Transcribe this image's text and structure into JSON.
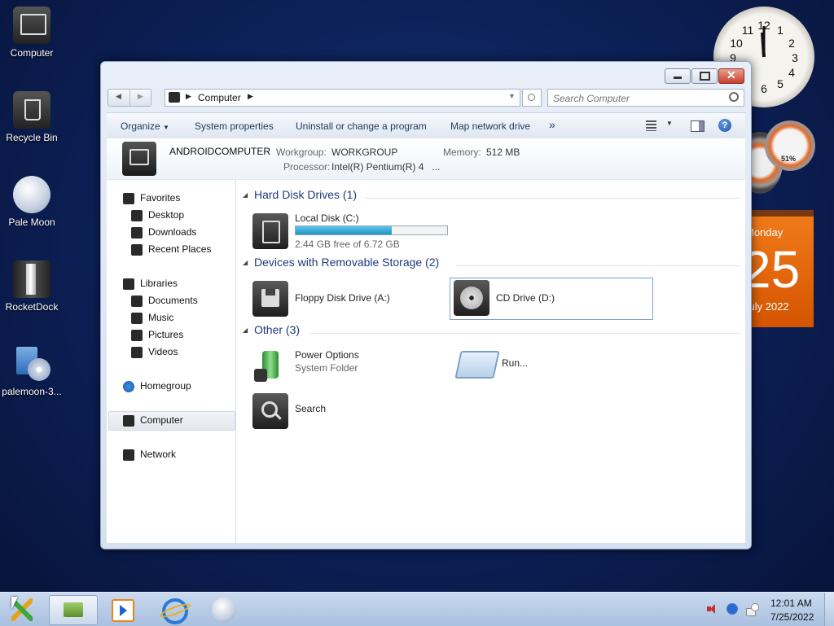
{
  "desktop": {
    "icons": [
      {
        "label": "Computer",
        "icon": "computer-icon"
      },
      {
        "label": "Recycle Bin",
        "icon": "recycle-bin-icon"
      },
      {
        "label": "Pale Moon",
        "icon": "pale-moon-icon"
      },
      {
        "label": "RocketDock",
        "icon": "rocketdock-icon"
      },
      {
        "label": "palemoon-3...",
        "icon": "installer-icon"
      }
    ]
  },
  "gadgets": {
    "calendar": {
      "day_name": "Monday",
      "day": "25",
      "month_year": "July 2022"
    },
    "meter": {
      "value": "51%"
    }
  },
  "window": {
    "address": {
      "root_label": "Computer"
    },
    "search": {
      "placeholder": "Search Computer"
    },
    "toolbar": {
      "organize": "Organize",
      "system_properties": "System properties",
      "uninstall": "Uninstall or change a program",
      "map_drive": "Map network drive",
      "more": "»"
    },
    "info": {
      "name": "ANDROIDCOMPUTER",
      "workgroup_label": "Workgroup:",
      "workgroup": "WORKGROUP",
      "memory_label": "Memory:",
      "memory": "512 MB",
      "processor_label": "Processor:",
      "processor": "Intel(R) Pentium(R) 4   ..."
    },
    "nav": {
      "favorites": "Favorites",
      "desktop": "Desktop",
      "downloads": "Downloads",
      "recent": "Recent Places",
      "libraries": "Libraries",
      "documents": "Documents",
      "music": "Music",
      "pictures": "Pictures",
      "videos": "Videos",
      "homegroup": "Homegroup",
      "computer": "Computer",
      "network": "Network"
    },
    "groups": {
      "hdd": "Hard Disk Drives (1)",
      "removable": "Devices with Removable Storage (2)",
      "other": "Other (3)"
    },
    "drives": {
      "c_label": "Local Disk (C:)",
      "c_free": "2.44 GB free of 6.72 GB",
      "c_used_fraction": 0.637,
      "floppy": "Floppy Disk Drive (A:)",
      "cd": "CD Drive (D:)"
    },
    "other": {
      "power": "Power Options",
      "power_sub": "System Folder",
      "run": "Run...",
      "search": "Search"
    }
  },
  "taskbar": {
    "time": "12:01 AM",
    "date": "7/25/2022"
  }
}
